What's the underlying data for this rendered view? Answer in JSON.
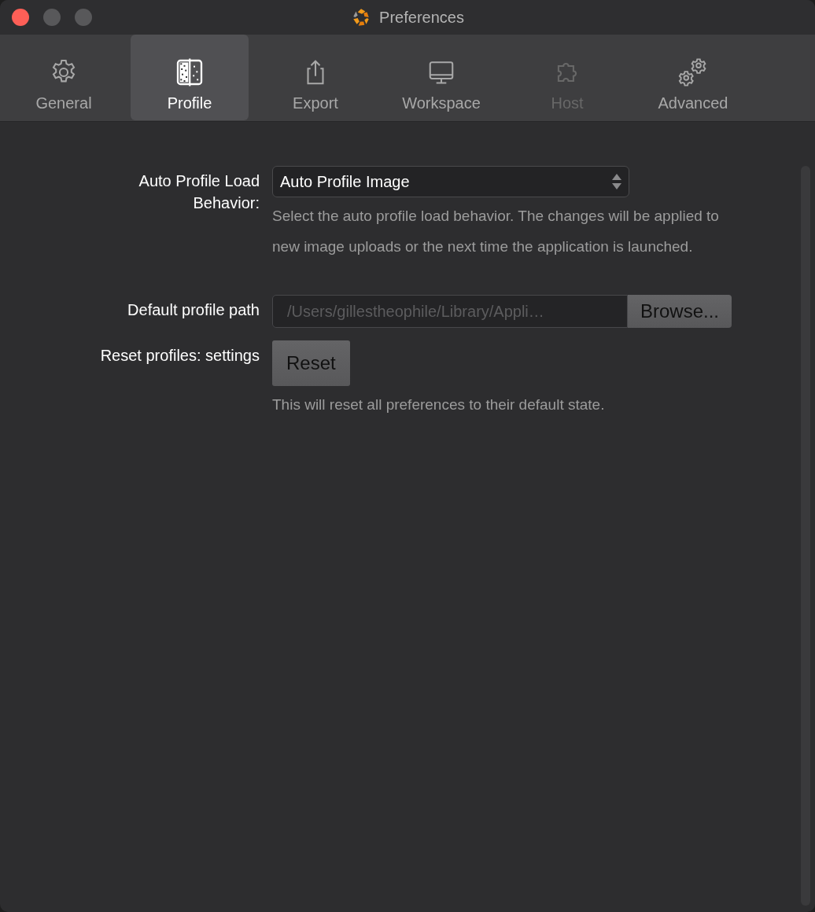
{
  "window": {
    "title": "Preferences"
  },
  "tabs": [
    {
      "label": "General",
      "selected": false,
      "disabled": false
    },
    {
      "label": "Profile",
      "selected": true,
      "disabled": false
    },
    {
      "label": "Export",
      "selected": false,
      "disabled": false
    },
    {
      "label": "Workspace",
      "selected": false,
      "disabled": false
    },
    {
      "label": "Host",
      "selected": false,
      "disabled": true
    },
    {
      "label": "Advanced",
      "selected": false,
      "disabled": false
    }
  ],
  "settings": [
    {
      "kind": "select",
      "label": "Auto Profile Load Behavior:",
      "value": "Auto Profile Image",
      "help": "Select the auto profile load behavior. The changes will be applied to new image uploads or the next time the application is launched."
    },
    {
      "kind": "path",
      "label": "Default profile path",
      "value": "/Users/gillestheophile/Library/Appli…",
      "disabled": true,
      "button": "Browse..."
    },
    {
      "kind": "button",
      "label": "Reset profiles: settings",
      "button": "Reset",
      "help": "This will reset all preferences to their default state."
    }
  ]
}
